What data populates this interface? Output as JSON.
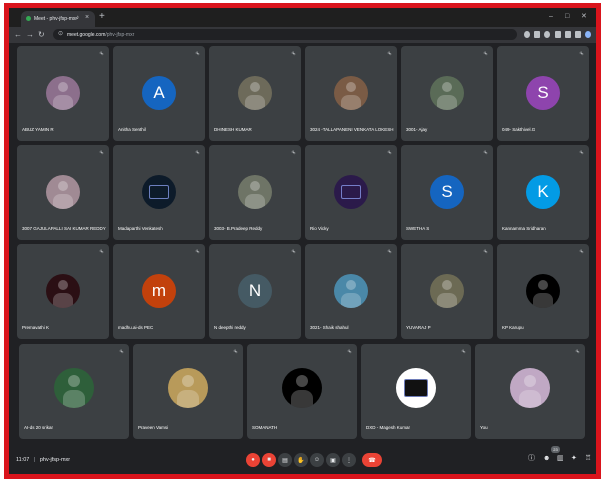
{
  "browser": {
    "tab_title": "Meet - phv-jfsp-mxr",
    "new_tab": "+",
    "url_domain": "meet.google.com",
    "url_path": "/phv-jfsp-mxr",
    "win_min": "–",
    "win_max": "□",
    "win_close": "✕"
  },
  "participants": [
    {
      "name": "ABUZ YAMIN R",
      "avatar_type": "photo",
      "color": "#8c6f8c"
    },
    {
      "name": "Anitha Senthil",
      "avatar_type": "letter",
      "initial": "A",
      "color": "#1565c0"
    },
    {
      "name": "DHINESH KUMAR",
      "avatar_type": "photo",
      "color": "#6d6a5a"
    },
    {
      "name": "3024 -TALLAPANENI VENKATA LOKESH",
      "avatar_type": "photo",
      "color": "#7a5b45"
    },
    {
      "name": "3001- Ajay",
      "avatar_type": "photo",
      "color": "#5a6b57"
    },
    {
      "name": "049- Sakthivel.G",
      "avatar_type": "letter",
      "initial": "S",
      "color": "#8e44ad"
    },
    {
      "name": "3007 GAJULAPALLI SAI KUMAR REDDY",
      "avatar_type": "photo",
      "color": "#a08a94"
    },
    {
      "name": "Madaparthi Venkatesh",
      "avatar_type": "logo",
      "color": "#0d1b2a"
    },
    {
      "name": "3003- B.Pradeep Reddy",
      "avatar_type": "photo",
      "color": "#6e7466"
    },
    {
      "name": "Rio Vicky",
      "avatar_type": "logo",
      "color": "#2b1a4a"
    },
    {
      "name": "SWETHA S",
      "avatar_type": "letter",
      "initial": "S",
      "color": "#1565c0"
    },
    {
      "name": "Kannamma Sridharan",
      "avatar_type": "letter",
      "initial": "K",
      "color": "#039be5"
    },
    {
      "name": "Premavathi K",
      "avatar_type": "photo",
      "color": "#2b0f14"
    },
    {
      "name": "madhu.ai-ds PEC",
      "avatar_type": "letter",
      "initial": "m",
      "color": "#c2410c"
    },
    {
      "name": "N deepthi reddy",
      "avatar_type": "letter",
      "initial": "N",
      "color": "#455a64"
    },
    {
      "name": "3021- Shaik shahul",
      "avatar_type": "photo",
      "color": "#4a88a8"
    },
    {
      "name": "YUVARAJ P",
      "avatar_type": "photo",
      "color": "#6c6a54"
    },
    {
      "name": "KP Karupu",
      "avatar_type": "photo",
      "color": "#000000"
    },
    {
      "name": "AI-ds 20 srikar",
      "avatar_type": "photo",
      "color": "#2e5f3a"
    },
    {
      "name": "Praveen Vamsi",
      "avatar_type": "photo",
      "color": "#b89a5a"
    },
    {
      "name": "SOMANATH",
      "avatar_type": "photo",
      "color": "#000000"
    },
    {
      "name": "DXD - Magesh Kumar",
      "avatar_type": "logo",
      "color": "#ffffff"
    },
    {
      "name": "You",
      "avatar_type": "photo",
      "color": "#c0a8c4"
    }
  ],
  "meeting": {
    "time": "11:07",
    "separator": "|",
    "code": "phv-jfsp-mxr"
  },
  "controls": {
    "mic": "mic-off-icon",
    "camera": "camera-off-icon",
    "captions": "captions-icon",
    "raise_hand": "raise-hand-icon",
    "emoji": "emoji-icon",
    "present": "present-icon",
    "more": "more-options-icon",
    "end_call": "end-call-icon",
    "participant_count": "23"
  },
  "icon_glyphs": {
    "mic_small": "✂",
    "back": "←",
    "forward": "→",
    "reload": "↻",
    "lock": "⊙",
    "close_tab": "×",
    "audio": "♪",
    "mic": "●",
    "camera": "■",
    "captions": "▤",
    "hand": "✋",
    "emoji": "☺",
    "present": "▣",
    "more": "⋮",
    "end": "☎",
    "info": "ⓘ",
    "people": "☻",
    "chat": "▥",
    "activities": "✦",
    "lock_host": "♖"
  }
}
